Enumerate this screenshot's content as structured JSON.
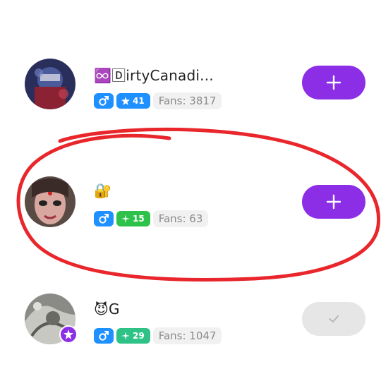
{
  "users": [
    {
      "name": "♾️🄳irtyCanadi...",
      "gender": "male",
      "level": "41",
      "level_color": "#1e90ff",
      "fans": "Fans: 3817",
      "following": false
    },
    {
      "name": "🔐",
      "gender": "male",
      "level": "15",
      "level_color": "#2ec24a",
      "fans": "Fans: 63",
      "following": false
    },
    {
      "name": "😈G",
      "gender": "male",
      "level": "29",
      "level_color": "#2ec287",
      "fans": "Fans: 1047",
      "following": true
    }
  ],
  "colors": {
    "follow_button": "#8b2ee6",
    "followed_button": "#e6e6e6",
    "gender_badge": "#1e90ff",
    "annotation": "#e8262b"
  },
  "icons": {
    "follow": "plus-icon",
    "followed": "check-icon",
    "gender": "male-icon"
  }
}
